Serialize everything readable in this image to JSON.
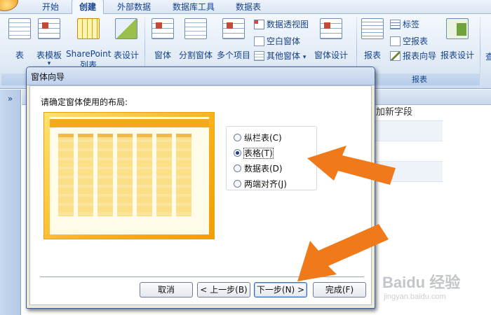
{
  "ribbon": {
    "tabs": [
      "开始",
      "创建",
      "外部数据",
      "数据库工具",
      "数据表"
    ],
    "active_tab": "创建",
    "buttons": {
      "table": "表",
      "table_template": "表模板",
      "sharepoint_line1": "SharePoint",
      "sharepoint_line2": "列表",
      "table_design": "表设计",
      "form": "窗体",
      "split_form": "分割窗体",
      "multi_items": "多个项目",
      "pivot_chart": "数据透视图",
      "blank_form": "空白窗体",
      "other_forms": "其他窗体",
      "form_design": "窗体设计",
      "report": "报表",
      "labels": "标签",
      "blank_report": "空报表",
      "report_wizard": "报表向导",
      "report_design": "报表设计",
      "query_partial": "查"
    },
    "group_labels": {
      "reports": "报表"
    },
    "colors": {
      "accent": "#15428b",
      "ribbon_bg": "#dfe9f5"
    }
  },
  "background": {
    "nav_chevron": "»",
    "column_header": "加新字段"
  },
  "dialog": {
    "title": "窗体向导",
    "prompt": "请确定窗体使用的布局:",
    "layout_options": [
      {
        "label": "纵栏表(C)",
        "checked": false
      },
      {
        "label": "表格(T)",
        "checked": true
      },
      {
        "label": "数据表(D)",
        "checked": false
      },
      {
        "label": "两端对齐(J)",
        "checked": false
      }
    ],
    "buttons": {
      "cancel": "取消",
      "back": "< 上一步(B)",
      "next": "下一步(N) >",
      "finish": "完成(F)"
    },
    "preview_color": "#f8b21a"
  },
  "annotation": {
    "arrow_color": "#f07a1a"
  },
  "watermark": {
    "brand": "Baidu 经验",
    "url": "jingyan.baidu.com"
  }
}
